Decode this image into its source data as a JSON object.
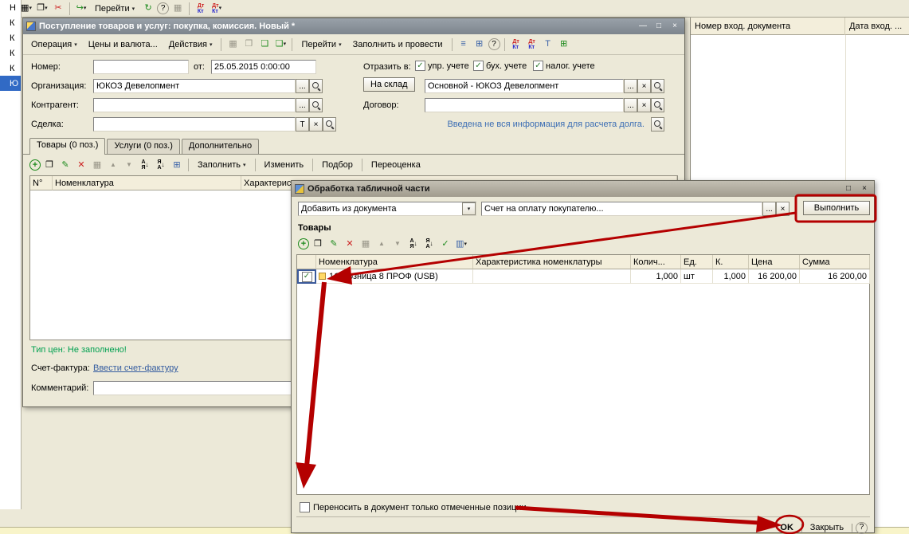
{
  "glyphs": {
    "dropdown": "▾",
    "refresh": "↻",
    "help": "?",
    "plus": "+",
    "copy": "❐",
    "pencil": "✎",
    "delete": "✕",
    "grid": "▦",
    "up": "▲",
    "down": "▼",
    "a": "А",
    "ya": "Я",
    "arrow_down": "↓",
    "list": "≡",
    "table": "⊞",
    "columns": "▥",
    "dt": "Дт",
    "kt": "Кт",
    "ellipsis": "...",
    "clear": "×",
    "t": "Т",
    "min": "—",
    "max": "□",
    "close": "×",
    "check": "✓",
    "doc": "❏",
    "cut": "✂",
    "go_arrow": "↪"
  },
  "app_toolbar": {
    "go": "Перейти"
  },
  "left_strip": {
    "letters": [
      "Н",
      "К",
      "К",
      "К",
      "К"
    ],
    "selected": "Ю"
  },
  "right_panel": {
    "col1": "Номер вход. документа",
    "col2": "Дата вход. ..."
  },
  "doc_window": {
    "title": "Поступление товаров и услуг: покупка, комиссия. Новый *",
    "toolbar": {
      "operation": "Операция",
      "prices": "Цены и валюта...",
      "actions": "Действия",
      "go": "Перейти",
      "fill_and_post": "Заполнить и провести"
    },
    "form": {
      "number_label": "Номер:",
      "number_value": "",
      "date_label": "от:",
      "date_value": "25.05.2015 0:00:00",
      "reflect_label": "Отразить в:",
      "cb_upr": "упр. учете",
      "cb_buh": "бух. учете",
      "cb_tax": "налог. учете",
      "org_label": "Организация:",
      "org_value": "ЮКОЗ Девелопмент",
      "warehouse_label": "На склад",
      "warehouse_value": "Основной - ЮКОЗ Девелопмент",
      "contragent_label": "Контрагент:",
      "contragent_value": "",
      "contract_label": "Договор:",
      "contract_value": "",
      "deal_label": "Сделка:",
      "deal_value": "",
      "warning": "Введена не вся информация для расчета долга."
    },
    "tabs": {
      "goods": "Товары (0 поз.)",
      "services": "Услуги (0 поз.)",
      "extra": "Дополнительно"
    },
    "table_toolbar": {
      "fill": "Заполнить",
      "change": "Изменить",
      "pick": "Подбор",
      "reprice": "Переоценка"
    },
    "table": {
      "col_num": "N°",
      "col_nomenclature": "Номенклатура",
      "col_characteristic": "Характеристика"
    },
    "footer": {
      "price_type": "Тип цен: Не заполнено!",
      "invoice_label": "Счет-фактура:",
      "invoice_link": "Ввести счет-фактуру",
      "comment_label": "Комментарий:"
    }
  },
  "dialog": {
    "title": "Обработка табличной части",
    "source_combo": "Добавить из документа",
    "document_field": "Счет на оплату покупателю...",
    "execute": "Выполнить",
    "section": "Товары",
    "table": {
      "col_nomenclature": "Номенклатура",
      "col_characteristic": "Характеристика номенклатуры",
      "col_qty": "Колич...",
      "col_unit": "Ед.",
      "col_k": "К.",
      "col_price": "Цена",
      "col_sum": "Сумма",
      "row": {
        "nomenclature": "1С:Розница 8 ПРОФ (USB)",
        "characteristic": "",
        "qty": "1,000",
        "unit": "шт",
        "k": "1,000",
        "price": "16 200,00",
        "sum": "16 200,00"
      }
    },
    "transfer_checkbox": "Переносить в документ только отмеченные позиции",
    "ok": "OK",
    "close": "Закрыть"
  }
}
